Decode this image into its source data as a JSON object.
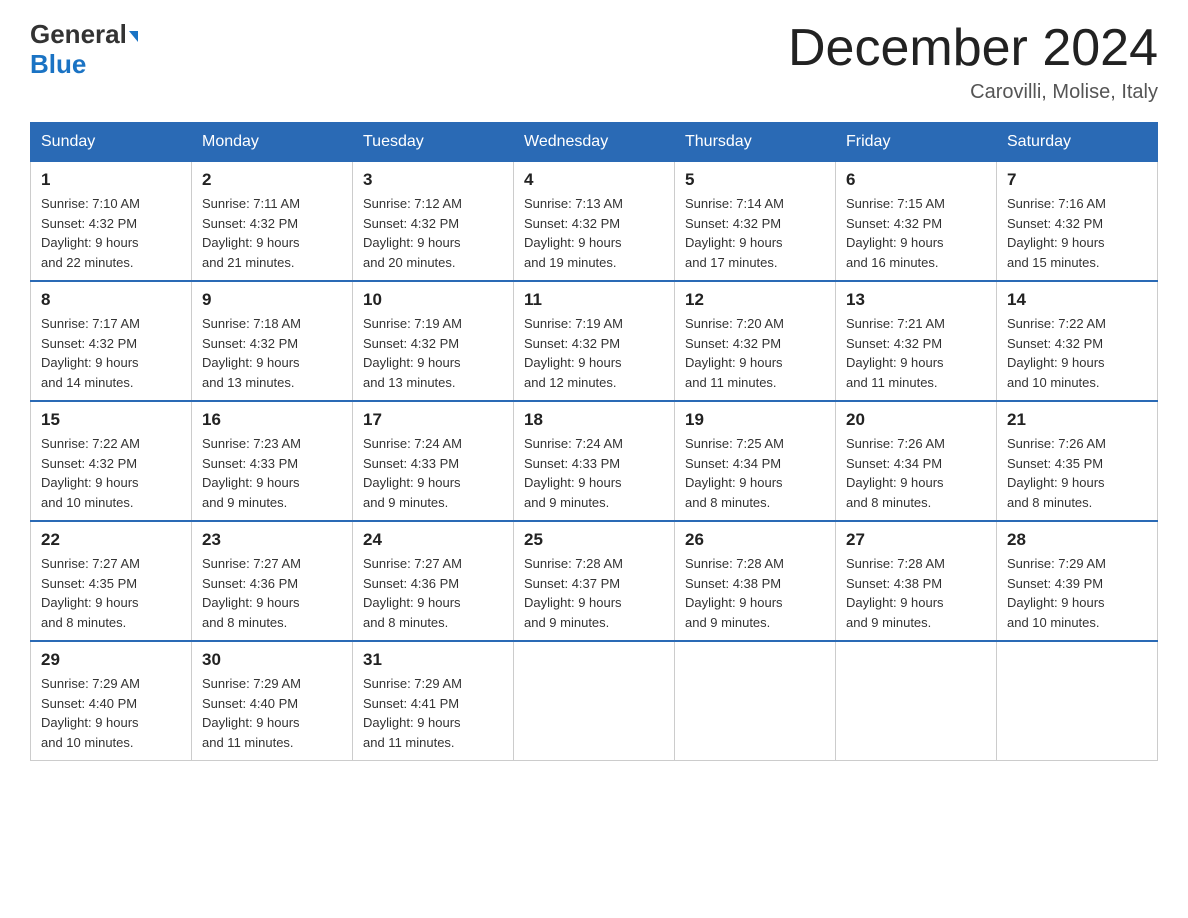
{
  "header": {
    "logo_line1": "General",
    "logo_line2": "Blue",
    "month_title": "December 2024",
    "location": "Carovilli, Molise, Italy"
  },
  "weekdays": [
    "Sunday",
    "Monday",
    "Tuesday",
    "Wednesday",
    "Thursday",
    "Friday",
    "Saturday"
  ],
  "weeks": [
    [
      {
        "day": "1",
        "sunrise": "7:10 AM",
        "sunset": "4:32 PM",
        "daylight": "9 hours and 22 minutes."
      },
      {
        "day": "2",
        "sunrise": "7:11 AM",
        "sunset": "4:32 PM",
        "daylight": "9 hours and 21 minutes."
      },
      {
        "day": "3",
        "sunrise": "7:12 AM",
        "sunset": "4:32 PM",
        "daylight": "9 hours and 20 minutes."
      },
      {
        "day": "4",
        "sunrise": "7:13 AM",
        "sunset": "4:32 PM",
        "daylight": "9 hours and 19 minutes."
      },
      {
        "day": "5",
        "sunrise": "7:14 AM",
        "sunset": "4:32 PM",
        "daylight": "9 hours and 17 minutes."
      },
      {
        "day": "6",
        "sunrise": "7:15 AM",
        "sunset": "4:32 PM",
        "daylight": "9 hours and 16 minutes."
      },
      {
        "day": "7",
        "sunrise": "7:16 AM",
        "sunset": "4:32 PM",
        "daylight": "9 hours and 15 minutes."
      }
    ],
    [
      {
        "day": "8",
        "sunrise": "7:17 AM",
        "sunset": "4:32 PM",
        "daylight": "9 hours and 14 minutes."
      },
      {
        "day": "9",
        "sunrise": "7:18 AM",
        "sunset": "4:32 PM",
        "daylight": "9 hours and 13 minutes."
      },
      {
        "day": "10",
        "sunrise": "7:19 AM",
        "sunset": "4:32 PM",
        "daylight": "9 hours and 13 minutes."
      },
      {
        "day": "11",
        "sunrise": "7:19 AM",
        "sunset": "4:32 PM",
        "daylight": "9 hours and 12 minutes."
      },
      {
        "day": "12",
        "sunrise": "7:20 AM",
        "sunset": "4:32 PM",
        "daylight": "9 hours and 11 minutes."
      },
      {
        "day": "13",
        "sunrise": "7:21 AM",
        "sunset": "4:32 PM",
        "daylight": "9 hours and 11 minutes."
      },
      {
        "day": "14",
        "sunrise": "7:22 AM",
        "sunset": "4:32 PM",
        "daylight": "9 hours and 10 minutes."
      }
    ],
    [
      {
        "day": "15",
        "sunrise": "7:22 AM",
        "sunset": "4:32 PM",
        "daylight": "9 hours and 10 minutes."
      },
      {
        "day": "16",
        "sunrise": "7:23 AM",
        "sunset": "4:33 PM",
        "daylight": "9 hours and 9 minutes."
      },
      {
        "day": "17",
        "sunrise": "7:24 AM",
        "sunset": "4:33 PM",
        "daylight": "9 hours and 9 minutes."
      },
      {
        "day": "18",
        "sunrise": "7:24 AM",
        "sunset": "4:33 PM",
        "daylight": "9 hours and 9 minutes."
      },
      {
        "day": "19",
        "sunrise": "7:25 AM",
        "sunset": "4:34 PM",
        "daylight": "9 hours and 8 minutes."
      },
      {
        "day": "20",
        "sunrise": "7:26 AM",
        "sunset": "4:34 PM",
        "daylight": "9 hours and 8 minutes."
      },
      {
        "day": "21",
        "sunrise": "7:26 AM",
        "sunset": "4:35 PM",
        "daylight": "9 hours and 8 minutes."
      }
    ],
    [
      {
        "day": "22",
        "sunrise": "7:27 AM",
        "sunset": "4:35 PM",
        "daylight": "9 hours and 8 minutes."
      },
      {
        "day": "23",
        "sunrise": "7:27 AM",
        "sunset": "4:36 PM",
        "daylight": "9 hours and 8 minutes."
      },
      {
        "day": "24",
        "sunrise": "7:27 AM",
        "sunset": "4:36 PM",
        "daylight": "9 hours and 8 minutes."
      },
      {
        "day": "25",
        "sunrise": "7:28 AM",
        "sunset": "4:37 PM",
        "daylight": "9 hours and 9 minutes."
      },
      {
        "day": "26",
        "sunrise": "7:28 AM",
        "sunset": "4:38 PM",
        "daylight": "9 hours and 9 minutes."
      },
      {
        "day": "27",
        "sunrise": "7:28 AM",
        "sunset": "4:38 PM",
        "daylight": "9 hours and 9 minutes."
      },
      {
        "day": "28",
        "sunrise": "7:29 AM",
        "sunset": "4:39 PM",
        "daylight": "9 hours and 10 minutes."
      }
    ],
    [
      {
        "day": "29",
        "sunrise": "7:29 AM",
        "sunset": "4:40 PM",
        "daylight": "9 hours and 10 minutes."
      },
      {
        "day": "30",
        "sunrise": "7:29 AM",
        "sunset": "4:40 PM",
        "daylight": "9 hours and 11 minutes."
      },
      {
        "day": "31",
        "sunrise": "7:29 AM",
        "sunset": "4:41 PM",
        "daylight": "9 hours and 11 minutes."
      },
      null,
      null,
      null,
      null
    ]
  ]
}
